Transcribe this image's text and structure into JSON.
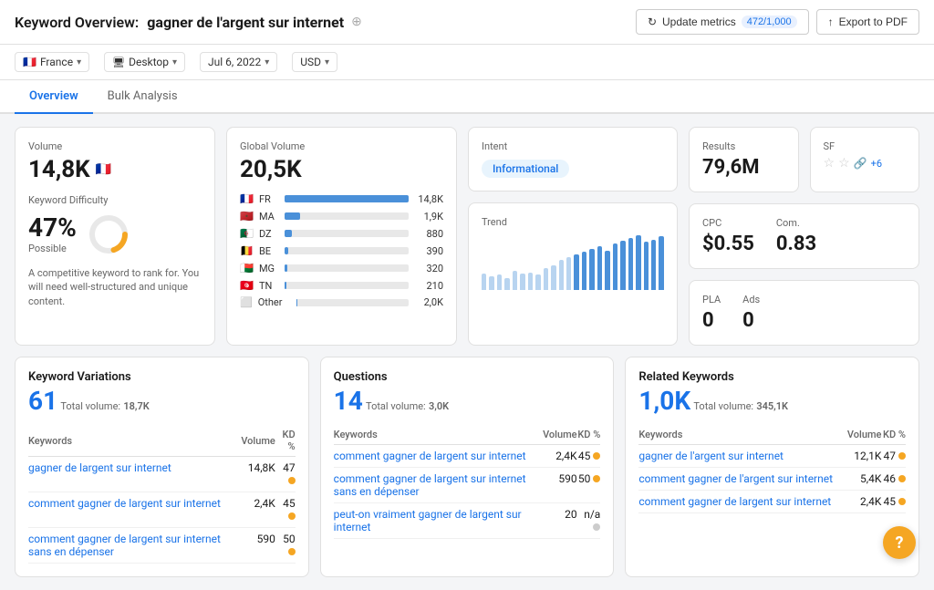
{
  "header": {
    "title_prefix": "Keyword Overview:",
    "title_keyword": "gagner de l'argent sur internet",
    "update_button": "Update metrics",
    "metrics_count": "472/1,000",
    "export_button": "Export to PDF"
  },
  "filters": {
    "country": "France",
    "device": "Desktop",
    "date": "Jul 6, 2022",
    "currency": "USD"
  },
  "tabs": {
    "active": "Overview",
    "items": [
      "Overview",
      "Bulk Analysis"
    ]
  },
  "volume_card": {
    "label": "Volume",
    "value": "14,8K"
  },
  "kd_card": {
    "kd_label": "Keyword Difficulty",
    "kd_value": "47%",
    "kd_possible": "Possible",
    "kd_percent": 47,
    "kd_description": "A competitive keyword to rank for. You will need well-structured and unique content."
  },
  "global_volume": {
    "label": "Global Volume",
    "value": "20,5K",
    "countries": [
      {
        "flag": "🇫🇷",
        "code": "FR",
        "value": 14800,
        "max": 14800,
        "label": "14,8K"
      },
      {
        "flag": "🇲🇦",
        "code": "MA",
        "value": 1900,
        "max": 14800,
        "label": "1,9K"
      },
      {
        "flag": "🇩🇿",
        "code": "DZ",
        "value": 880,
        "max": 14800,
        "label": "880"
      },
      {
        "flag": "🇧🇪",
        "code": "BE",
        "value": 390,
        "max": 14800,
        "label": "390"
      },
      {
        "flag": "🇲🇬",
        "code": "MG",
        "value": 320,
        "max": 14800,
        "label": "320"
      },
      {
        "flag": "🇹🇳",
        "code": "TN",
        "value": 210,
        "max": 14800,
        "label": "210"
      }
    ],
    "other_label": "Other",
    "other_value": 200,
    "other_label_display": "2,0K"
  },
  "intent_card": {
    "label": "Intent",
    "badge": "Informational"
  },
  "trend_card": {
    "label": "Trend",
    "bars": [
      30,
      25,
      28,
      22,
      35,
      30,
      32,
      28,
      40,
      45,
      55,
      60,
      65,
      70,
      75,
      80,
      72,
      85,
      90,
      95,
      100,
      88,
      92,
      98
    ]
  },
  "results_card": {
    "label": "Results",
    "value": "79,6M",
    "sf_label": "SF"
  },
  "cpc_card": {
    "cpc_label": "CPC",
    "cpc_value": "$0.55",
    "com_label": "Com.",
    "com_value": "0.83"
  },
  "pla_ads_card": {
    "pla_label": "PLA",
    "pla_value": "0",
    "ads_label": "Ads",
    "ads_value": "0"
  },
  "keyword_variations": {
    "section_title": "Keyword Variations",
    "count": "61",
    "total_label": "Total volume:",
    "total_value": "18,7K",
    "col_keywords": "Keywords",
    "col_volume": "Volume",
    "col_kd": "KD %",
    "rows": [
      {
        "keyword": "gagner de largent sur internet",
        "volume": "14,8K",
        "kd": "47",
        "kd_color": "orange"
      },
      {
        "keyword": "comment gagner de largent sur internet",
        "volume": "2,4K",
        "kd": "45",
        "kd_color": "orange"
      },
      {
        "keyword": "comment gagner de largent sur internet sans en dépenser",
        "volume": "590",
        "kd": "50",
        "kd_color": "orange"
      }
    ]
  },
  "questions": {
    "section_title": "Questions",
    "count": "14",
    "total_label": "Total volume:",
    "total_value": "3,0K",
    "col_keywords": "Keywords",
    "col_volume": "Volume",
    "col_kd": "KD %",
    "rows": [
      {
        "keyword": "comment gagner de largent sur internet",
        "volume": "2,4K",
        "kd": "45",
        "kd_color": "orange"
      },
      {
        "keyword": "comment gagner de largent sur internet sans en dépenser",
        "volume": "590",
        "kd": "50",
        "kd_color": "orange"
      },
      {
        "keyword": "peut-on vraiment gagner de largent sur internet",
        "volume": "20",
        "kd": "n/a",
        "kd_color": "gray"
      }
    ]
  },
  "related_keywords": {
    "section_title": "Related Keywords",
    "count": "1,0K",
    "total_label": "Total volume:",
    "total_value": "345,1K",
    "col_keywords": "Keywords",
    "col_volume": "Volume",
    "col_kd": "KD %",
    "rows": [
      {
        "keyword": "gagner de l'argent sur internet",
        "volume": "12,1K",
        "kd": "47",
        "kd_color": "orange"
      },
      {
        "keyword": "comment gagner de l'argent sur internet",
        "volume": "5,4K",
        "kd": "46",
        "kd_color": "orange"
      },
      {
        "keyword": "comment gagner de largent sur internet",
        "volume": "2,4K",
        "kd": "45",
        "kd_color": "orange"
      }
    ]
  },
  "help_button": "?"
}
